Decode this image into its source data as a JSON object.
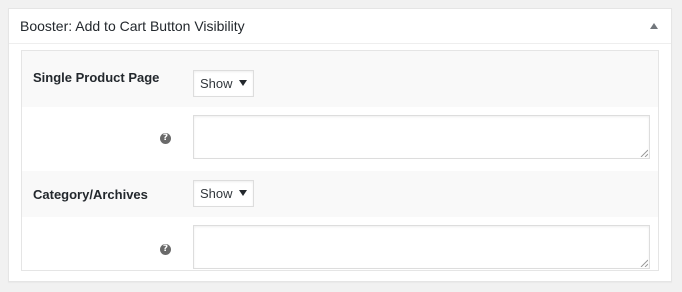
{
  "metabox": {
    "title": "Booster: Add to Cart Button Visibility",
    "toggle_icon": "triangle-up-icon"
  },
  "settings": [
    {
      "label": "Single Product Page",
      "select_value": "Show",
      "help_icon": "question-mark-icon",
      "textarea_value": ""
    },
    {
      "label": "Category/Archives",
      "select_value": "Show",
      "help_icon": "question-mark-icon",
      "textarea_value": ""
    }
  ],
  "colors": {
    "page_background": "#f1f1f1",
    "panel_background": "#ffffff",
    "row_shade": "#f9f9f9",
    "border": "#dddddd",
    "text": "#23282d"
  }
}
